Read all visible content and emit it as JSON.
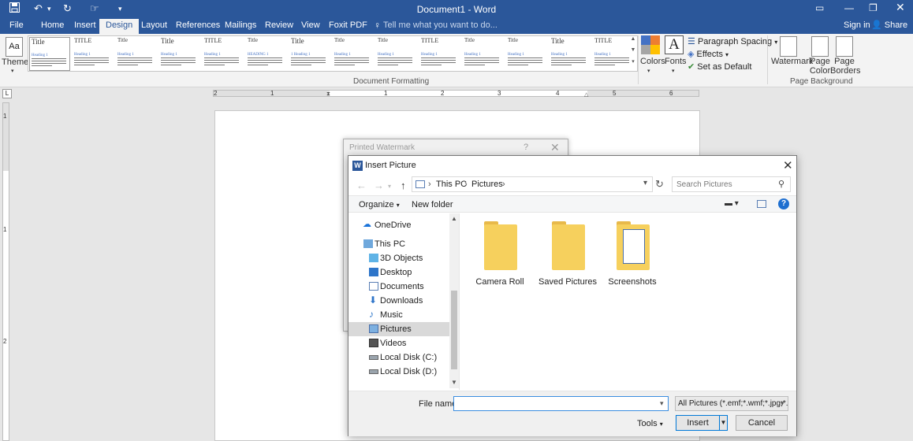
{
  "window": {
    "title": "Document1 - Word",
    "quick_access": [
      "save-icon",
      "undo-icon",
      "redo-icon",
      "touch-mode-icon",
      "customize-icon"
    ]
  },
  "tabs": [
    "File",
    "Home",
    "Insert",
    "Design",
    "Layout",
    "References",
    "Mailings",
    "Review",
    "View",
    "Foxit PDF"
  ],
  "active_tab": "Design",
  "tell_me": "Tell me what you want to do...",
  "sign_in": "Sign in",
  "share": "Share",
  "ribbon": {
    "themes": "Themes",
    "style_thumbs": [
      {
        "title": "Title",
        "heading": "Heading 1"
      },
      {
        "title": "TITLE",
        "heading": "Heading 1"
      },
      {
        "title": "Title",
        "heading": "Heading 1"
      },
      {
        "title": "Title",
        "heading": "Heading 1"
      },
      {
        "title": "TITLE",
        "heading": "Heading 1"
      },
      {
        "title": "Title",
        "heading": "HEADING 1"
      },
      {
        "title": "Title",
        "heading": "1 Heading 1"
      },
      {
        "title": "Title",
        "heading": "Heading 1"
      },
      {
        "title": "Title",
        "heading": "Heading 1"
      },
      {
        "title": "TITLE",
        "heading": "Heading 1"
      },
      {
        "title": "Title",
        "heading": "Heading 1"
      },
      {
        "title": "Title",
        "heading": "Heading 1"
      },
      {
        "title": "Title",
        "heading": "Heading 1"
      },
      {
        "title": "TITLE",
        "heading": "Heading 1"
      }
    ],
    "document_formatting": "Document Formatting",
    "colors": "Colors",
    "fonts": "Fonts",
    "fonts_glyph": "A",
    "paragraph_spacing": "Paragraph Spacing",
    "effects": "Effects",
    "set_as_default": "Set as Default",
    "watermark": "Watermark",
    "page_color": "Page Color",
    "page_borders": "Page Borders",
    "page_background": "Page Background"
  },
  "ruler": {
    "h_numbers": [
      "2",
      "1",
      "1",
      "2",
      "3",
      "4",
      "5",
      "6"
    ],
    "v_numbers": [
      "1",
      "1",
      "2"
    ]
  },
  "watermark_dialog": {
    "title": "Printed Watermark",
    "help": "?",
    "close": "✕"
  },
  "insert_dialog": {
    "title": "Insert Picture",
    "word_badge": "W",
    "close": "✕",
    "breadcrumbs": [
      "This PC",
      "Pictures"
    ],
    "search_placeholder": "Search Pictures",
    "organize": "Organize",
    "new_folder": "New folder",
    "help": "?",
    "nav_items": [
      {
        "label": "OneDrive",
        "icon": "onedrive-icon"
      },
      {
        "label": "This PC",
        "icon": "this-pc-icon"
      },
      {
        "label": "3D Objects",
        "icon": "3d-objects-icon"
      },
      {
        "label": "Desktop",
        "icon": "desktop-icon"
      },
      {
        "label": "Documents",
        "icon": "documents-icon"
      },
      {
        "label": "Downloads",
        "icon": "downloads-icon"
      },
      {
        "label": "Music",
        "icon": "music-icon"
      },
      {
        "label": "Pictures",
        "icon": "pictures-icon"
      },
      {
        "label": "Videos",
        "icon": "videos-icon"
      },
      {
        "label": "Local Disk (C:)",
        "icon": "local-disk-icon"
      },
      {
        "label": "Local Disk (D:)",
        "icon": "local-disk-icon"
      }
    ],
    "selected_nav": "Pictures",
    "folders": [
      "Camera Roll",
      "Saved Pictures",
      "Screenshots"
    ],
    "file_name_label": "File name:",
    "file_name_value": "",
    "filter": "All Pictures (*.emf;*.wmf;*.jpg;*.j",
    "tools": "Tools",
    "insert": "Insert",
    "cancel": "Cancel"
  },
  "colors": {
    "brand": "#2b579a",
    "folder": "#f6d05d",
    "focus": "#0078d7"
  }
}
